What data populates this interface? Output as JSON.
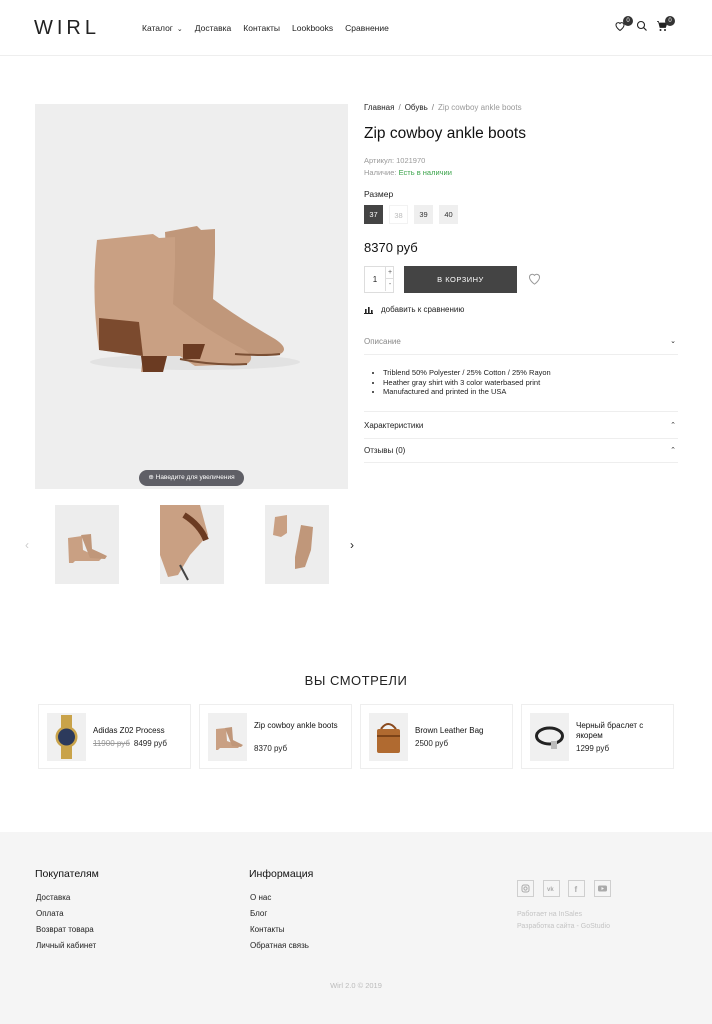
{
  "header": {
    "logo": "WIRL",
    "nav": [
      "Каталог",
      "Доставка",
      "Контакты",
      "Lookbooks",
      "Сравнение"
    ],
    "wishlist_count": "0",
    "cart_count": "0"
  },
  "gallery": {
    "zoom_hint": "Наведите для увеличения"
  },
  "product": {
    "breadcrumb": [
      "Главная",
      "Обувь",
      "Zip cowboy ankle boots"
    ],
    "title": "Zip cowboy ankle boots",
    "sku": "Артикул: 1021970",
    "stock_label": "Наличие:",
    "stock_value": "Есть в наличии",
    "size_label": "Размер",
    "sizes": [
      "37",
      "38",
      "39",
      "40"
    ],
    "price": "8370 руб",
    "quantity": "1",
    "qty_plus": "+",
    "qty_minus": "-",
    "cart_button": "В КОРЗИНУ",
    "compare": "добавить к сравнению",
    "accordion": {
      "description": "Описание",
      "characteristics": "Характеристики",
      "reviews": "Отзывы (0)"
    },
    "description_items": [
      "Triblend 50% Polyester / 25% Cotton / 25% Rayon",
      "Heather gray shirt with 3 color waterbased print",
      "Manufactured and printed in the USA"
    ]
  },
  "viewed": {
    "title": "ВЫ СМОТРЕЛИ",
    "items": [
      {
        "name": "Adidas Z02 Process",
        "old_price": "11900 руб",
        "price": "8499 руб"
      },
      {
        "name": "Zip cowboy ankle boots",
        "price": "8370 руб"
      },
      {
        "name": "Brown Leather Bag",
        "price": "2500 руб"
      },
      {
        "name": "Черный браслет с якорем",
        "price": "1299 руб"
      }
    ]
  },
  "footer": {
    "col1_title": "Покупателям",
    "col1_links": [
      "Доставка",
      "Оплата",
      "Возврат товара",
      "Личный кабинет"
    ],
    "col2_title": "Информация",
    "col2_links": [
      "О нас",
      "Блог",
      "Контакты",
      "Обратная связь"
    ],
    "social": [
      "instagram-icon",
      "vk-icon",
      "facebook-icon",
      "youtube-icon"
    ],
    "powered": "Работает на InSales",
    "developer": "Разработка сайта - GoStudio",
    "copyright": "Wirl 2.0 © 2019"
  }
}
